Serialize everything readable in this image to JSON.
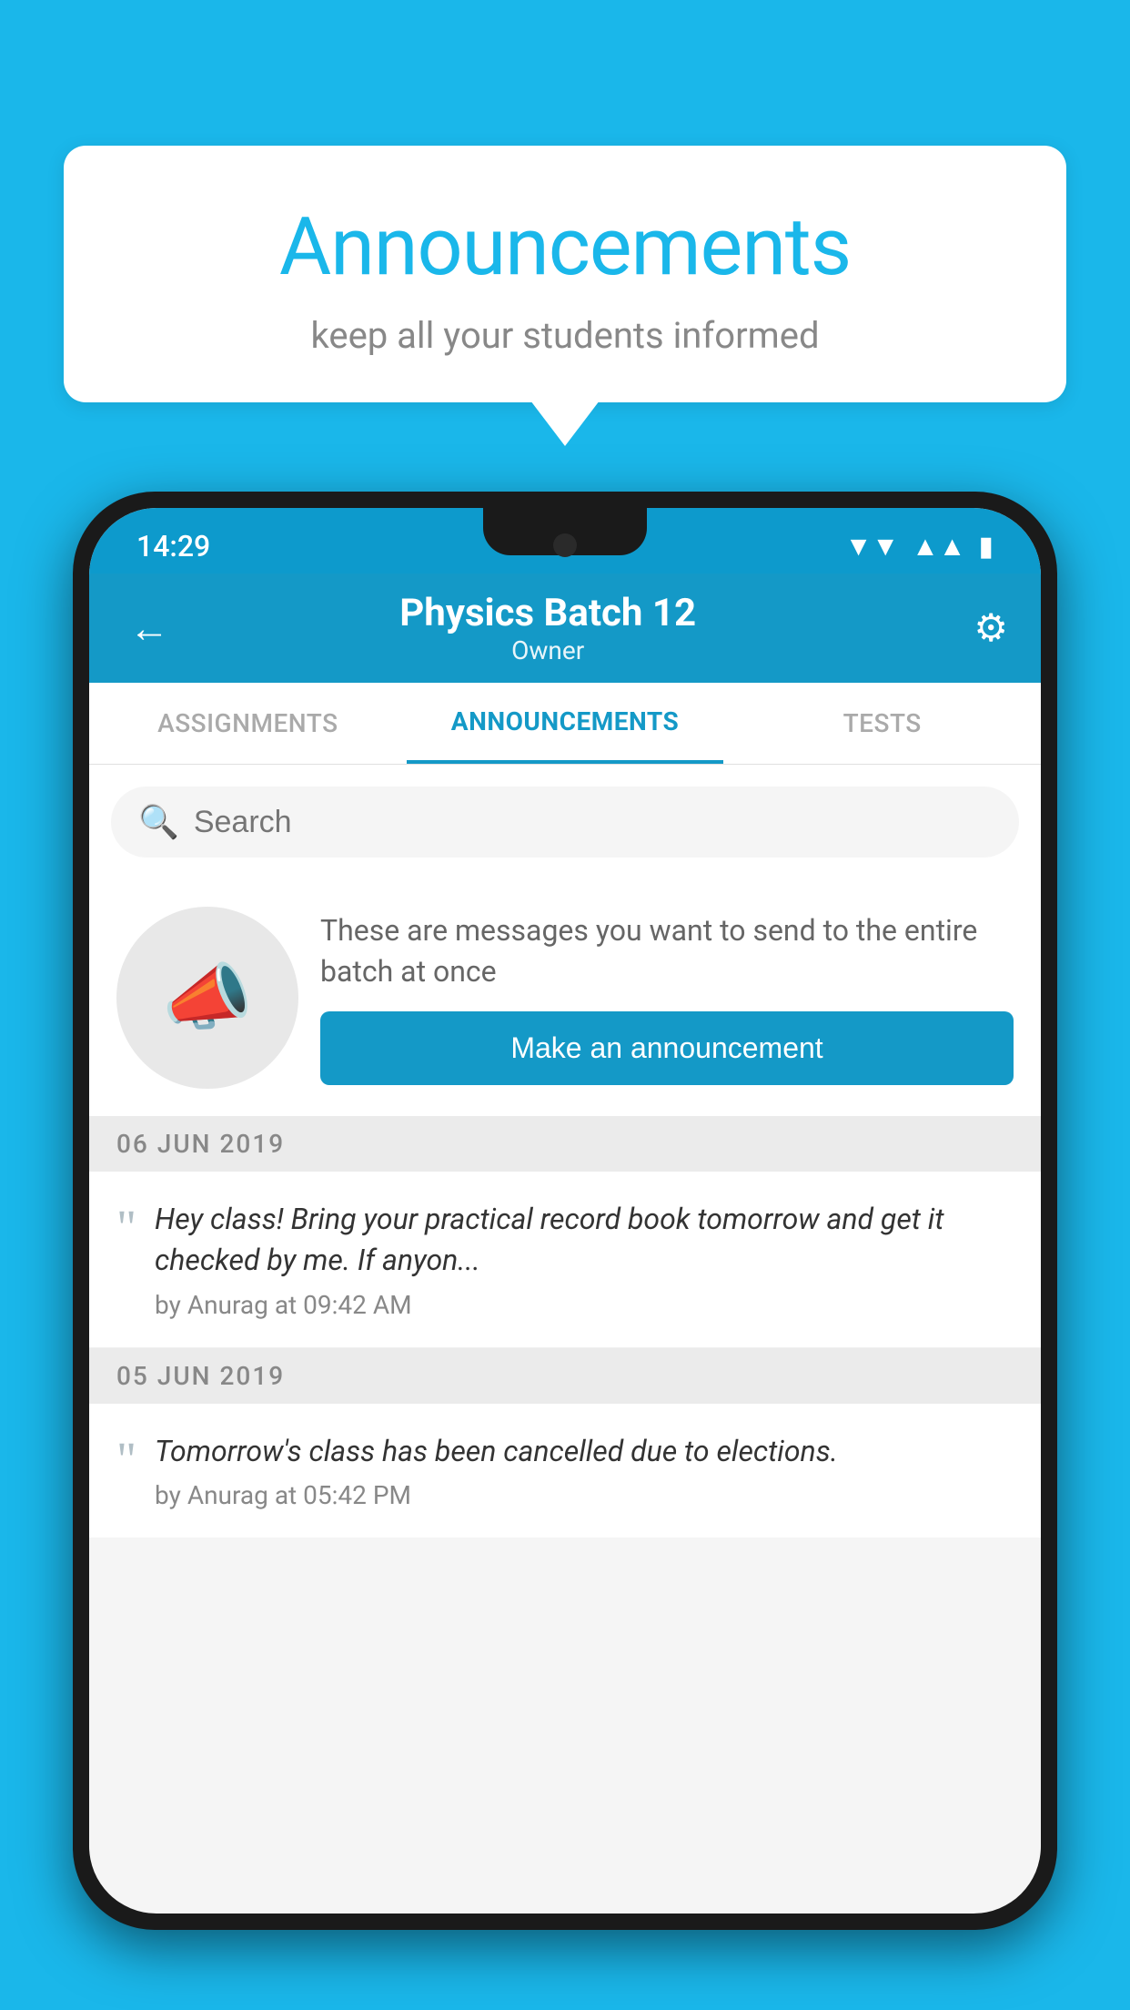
{
  "bubble": {
    "title": "Announcements",
    "subtitle": "keep all your students informed"
  },
  "statusBar": {
    "time": "14:29",
    "wifiIcon": "▼",
    "signalIcon": "▲",
    "batteryIcon": "▮"
  },
  "appBar": {
    "backIcon": "←",
    "title": "Physics Batch 12",
    "subtitle": "Owner",
    "settingsIcon": "⚙"
  },
  "tabs": [
    {
      "label": "ASSIGNMENTS",
      "active": false
    },
    {
      "label": "ANNOUNCEMENTS",
      "active": true
    },
    {
      "label": "TESTS",
      "active": false
    }
  ],
  "search": {
    "placeholder": "Search"
  },
  "promo": {
    "description": "These are messages you want to send to the entire batch at once",
    "buttonLabel": "Make an announcement"
  },
  "announcements": [
    {
      "date": "06  JUN  2019",
      "text": "Hey class! Bring your practical record book tomorrow and get it checked by me. If anyon...",
      "meta": "by Anurag at 09:42 AM"
    },
    {
      "date": "05  JUN  2019",
      "text": "Tomorrow's class has been cancelled due to elections.",
      "meta": "by Anurag at 05:42 PM"
    }
  ],
  "colors": {
    "primary": "#1499c7",
    "background": "#1ab7ea"
  }
}
